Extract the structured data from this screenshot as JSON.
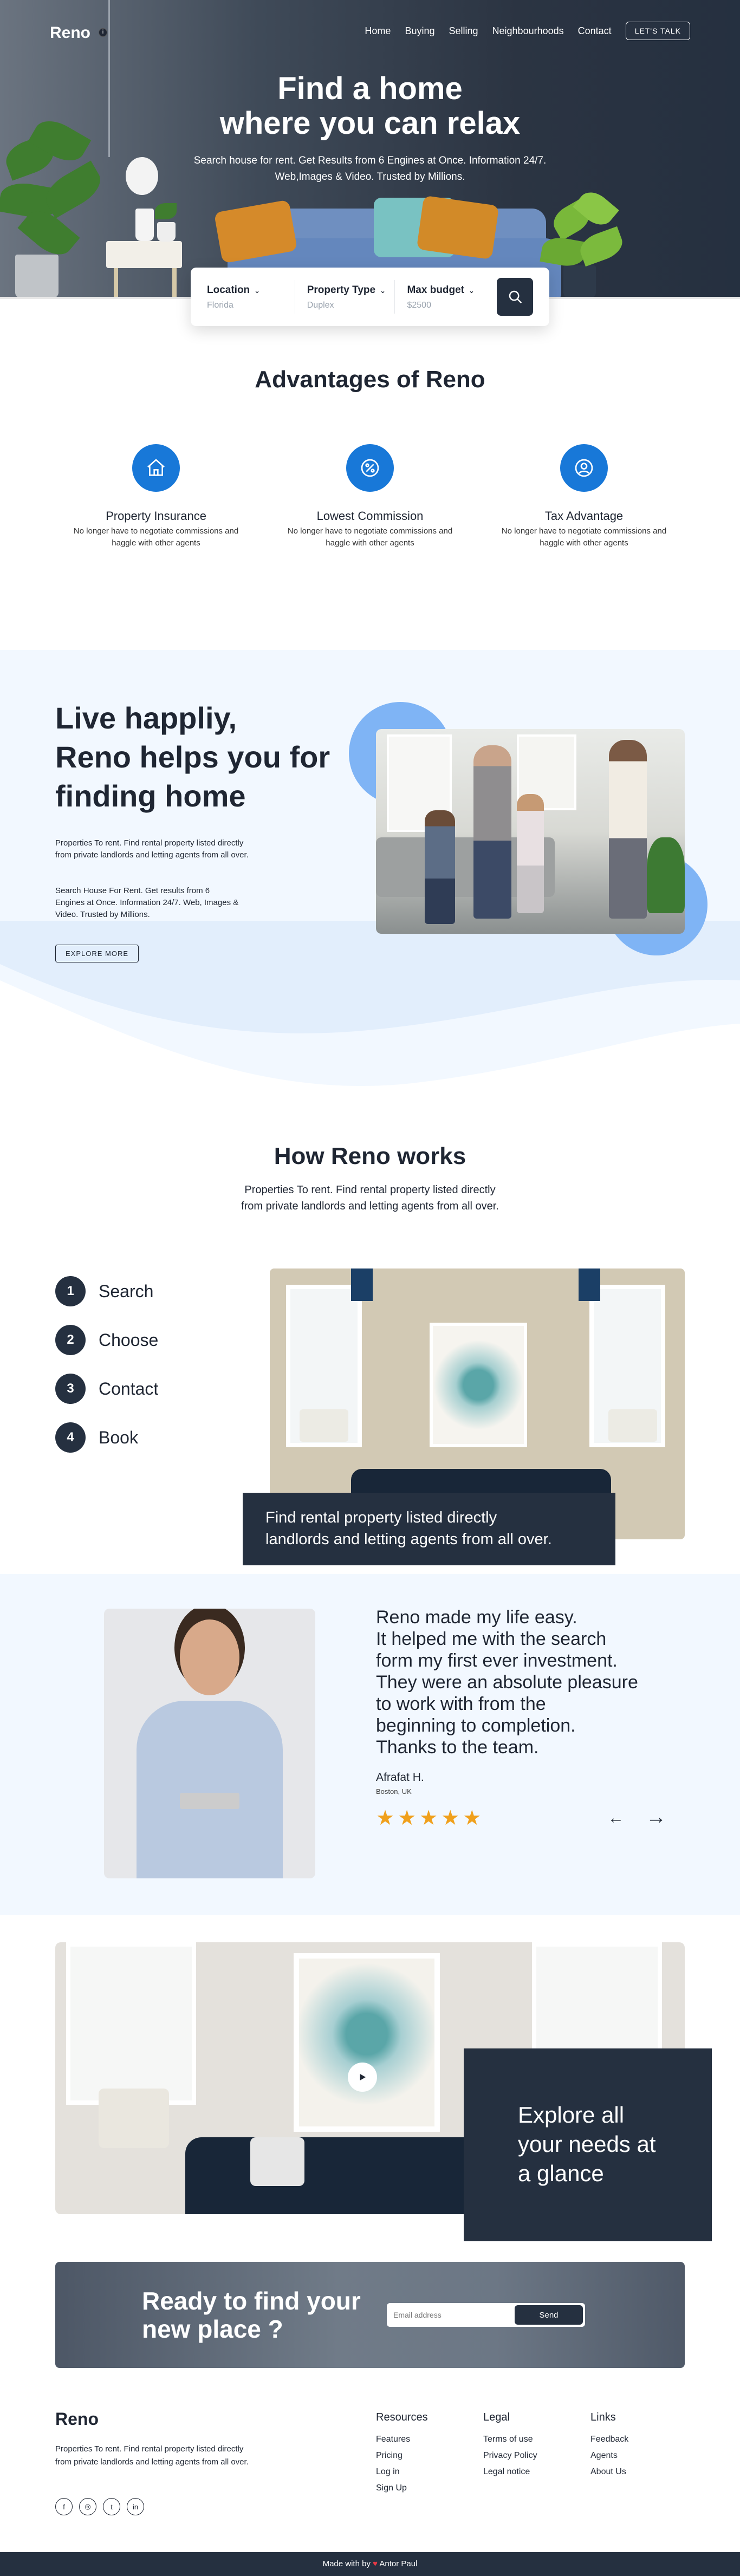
{
  "brand": "Reno",
  "nav": {
    "items": [
      "Home",
      "Buying",
      "Selling",
      "Neighbourhoods",
      "Contact"
    ],
    "cta": "LET'S TALK"
  },
  "hero": {
    "title_line1": "Find a home",
    "title_line2": "where you can relax",
    "subtitle_line1": "Search house for rent. Get Results from 6 Engines at Once. Information 24/7.",
    "subtitle_line2": "Web,Images & Video. Trusted by Millions."
  },
  "search": {
    "fields": [
      {
        "label": "Location",
        "value": "Florida"
      },
      {
        "label": "Property Type",
        "value": "Duplex"
      },
      {
        "label": "Max budget",
        "value": "$2500"
      }
    ]
  },
  "advantages": {
    "title": "Advantages of Reno",
    "items": [
      {
        "title": "Property Insurance",
        "line1": "No longer have to negotiate commissions and",
        "line2": "haggle with other agents",
        "icon": "house-icon"
      },
      {
        "title": "Lowest Commission",
        "line1": "No longer have to negotiate commissions and",
        "line2": "haggle with other agents",
        "icon": "percent-icon"
      },
      {
        "title": "Tax Advantage",
        "line1": "No longer have to negotiate commissions and",
        "line2": "haggle with other agents",
        "icon": "user-icon"
      }
    ]
  },
  "live": {
    "line1": "Live happliy,",
    "line2": "Reno helps you for",
    "line3": "finding home",
    "p1": "Properties To rent. Find rental property listed directly from private landlords and letting agents from all over.",
    "p2": "Search House For Rent. Get results from 6 Engines at Once. Information 24/7. Web, Images & Video. Trusted by Millions.",
    "button": "EXPLORE MORE"
  },
  "how": {
    "title": "How Reno works",
    "subtitle": "Properties To rent. Find rental property listed directly from private landlords and letting agents from all over.",
    "steps": [
      {
        "num": "1",
        "label": "Search"
      },
      {
        "num": "2",
        "label": "Choose"
      },
      {
        "num": "3",
        "label": "Contact"
      },
      {
        "num": "4",
        "label": "Book"
      }
    ],
    "caption_line1": "Find rental property listed directly",
    "caption_line2": "landlords and letting agents from all over."
  },
  "testimonial": {
    "quote_lines": [
      "Reno made my life easy.",
      "It helped me with the search",
      "form my first ever investment.",
      "They were an absolute pleasure",
      "to work with from the",
      "beginning to completion.",
      "Thanks to the team."
    ],
    "name": "Afrafat H.",
    "location": "Boston, UK",
    "rating": 5,
    "stars": "★★★★★",
    "prev_icon": "←",
    "next_icon": "→"
  },
  "explore": {
    "line1": "Explore all",
    "line2": "your needs at",
    "line3": "a glance"
  },
  "ready": {
    "line1": "Ready to find your",
    "line2": "new place ?",
    "email_placeholder": "Email address",
    "send": "Send"
  },
  "footer": {
    "logo": "Reno",
    "description": "Properties To rent. Find rental property listed directly from private landlords and letting agents from all over.",
    "columns": [
      {
        "title": "Resources",
        "links": [
          "Features",
          "Pricing",
          "Log in",
          "Sign Up"
        ]
      },
      {
        "title": "Legal",
        "links": [
          "Terms of use",
          "Privacy Policy",
          "Legal notice"
        ]
      },
      {
        "title": "Links",
        "links": [
          "Feedback",
          "Agents",
          "About Us"
        ]
      }
    ],
    "social": [
      "facebook-icon",
      "instagram-icon",
      "twitter-icon",
      "linkedin-icon"
    ],
    "credit_prefix": "Made with by",
    "credit_heart": "♥",
    "credit_name": "Antor Paul"
  },
  "colors": {
    "primary_dark": "#253040",
    "accent_blue": "#1878d8",
    "light_bg": "#f2f8ff",
    "star": "#f0a01c"
  }
}
